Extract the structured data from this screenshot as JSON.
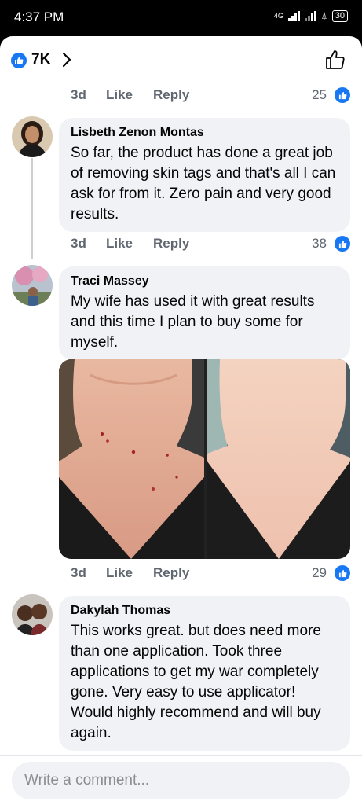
{
  "status_bar": {
    "time": "4:37 PM",
    "network": "4G",
    "battery": "30"
  },
  "header": {
    "reaction_count": "7K"
  },
  "comments": [
    {
      "meta": {
        "age": "3d",
        "like": "Like",
        "reply": "Reply",
        "reactions": "25"
      }
    },
    {
      "author": "Lisbeth Zenon Montas",
      "text": "So far, the product has done a great job of removing skin tags and that's all I can ask for from it. Zero pain and very good results.",
      "meta": {
        "age": "3d",
        "like": "Like",
        "reply": "Reply",
        "reactions": "38"
      }
    },
    {
      "author": "Traci Massey",
      "text": "My wife has used it with great results and this time I plan to buy some for myself.",
      "meta": {
        "age": "3d",
        "like": "Like",
        "reply": "Reply",
        "reactions": "29"
      }
    },
    {
      "author": "Dakylah Thomas",
      "text": "This works great. but does need more than one application. Took three applications to get my war completely gone. Very easy to use applicator! Would highly recommend and will buy again."
    }
  ],
  "composer": {
    "placeholder": "Write a comment..."
  },
  "colors": {
    "accent": "#1877f2",
    "bubble": "#f0f2f5",
    "meta_text": "#606770"
  }
}
